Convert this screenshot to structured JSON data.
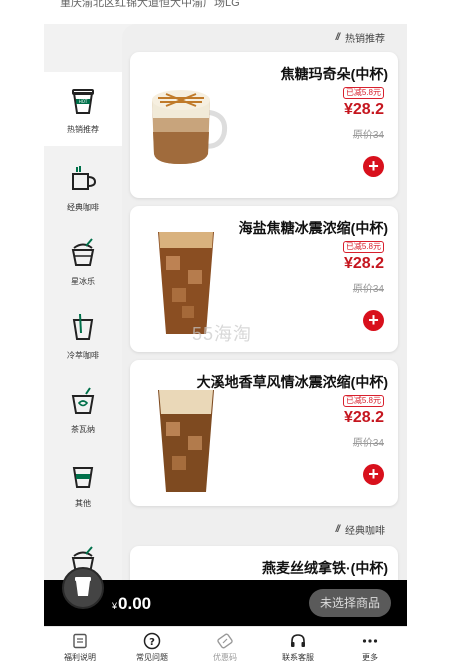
{
  "header": {
    "address": "重庆渝北区红锦大道恒大中渝广场LG"
  },
  "sidebar": {
    "items": [
      {
        "label": "热销推荐",
        "icon": "hot-cup-icon",
        "active": true
      },
      {
        "label": "经典咖啡",
        "icon": "coffee-mug-icon",
        "active": false
      },
      {
        "label": "星冰乐",
        "icon": "frappuccino-icon",
        "active": false
      },
      {
        "label": "冷萃咖啡",
        "icon": "cold-brew-icon",
        "active": false
      },
      {
        "label": "茶瓦纳",
        "icon": "tea-icon",
        "active": false
      },
      {
        "label": "其他",
        "icon": "other-cup-icon",
        "active": false
      }
    ]
  },
  "sections": {
    "hot": {
      "title": "热销推荐"
    },
    "classic": {
      "title": "经典咖啡"
    }
  },
  "products": [
    {
      "name": "焦糖玛奇朵(中杯)",
      "discount": "已减5.8元",
      "price": "¥28.2",
      "original": "原价34"
    },
    {
      "name": "海盐焦糖冰震浓缩(中杯)",
      "discount": "已减5.8元",
      "price": "¥28.2",
      "original": "原价34"
    },
    {
      "name": "大溪地香草风情冰震浓缩(中杯)",
      "discount": "已减5.8元",
      "price": "¥28.2",
      "original": "原价34"
    },
    {
      "name": "燕麦丝绒拿铁·(中杯)"
    }
  ],
  "watermark": "55海淘",
  "cart": {
    "currency": "¥",
    "total": "0.00",
    "status": "未选择商品"
  },
  "tabs": [
    {
      "label": "福利说明",
      "icon": "doc-icon",
      "muted": false
    },
    {
      "label": "常见问题",
      "icon": "question-icon",
      "muted": false
    },
    {
      "label": "优惠码",
      "icon": "coupon-icon",
      "muted": true
    },
    {
      "label": "联系客服",
      "icon": "headset-icon",
      "muted": false
    },
    {
      "label": "更多",
      "icon": "more-icon",
      "muted": false
    }
  ],
  "colors": {
    "accent_red": "#d8101c",
    "starbucks_green": "#00704a",
    "cart_bar": "#000000"
  }
}
